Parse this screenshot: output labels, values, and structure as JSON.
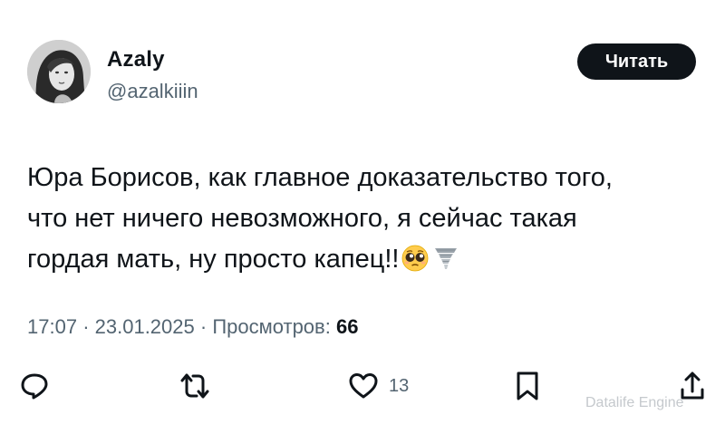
{
  "author": {
    "display_name": "Azaly",
    "handle": "@azalkiiin"
  },
  "follow_button": {
    "label": "Читать"
  },
  "tweet": {
    "lines": [
      "Юра Борисов, как главное доказательство того,",
      "что нет ничего невозможного, я сейчас такая",
      "гордая мать, ну просто капец!!"
    ],
    "emojis": [
      "pleading-face",
      "tornado"
    ]
  },
  "meta": {
    "time": "17:07",
    "separator": "·",
    "date": "23.01.2025",
    "views_label": "Просмотров:",
    "views_count": "66"
  },
  "actions": {
    "reply_icon": "reply-icon",
    "repost_icon": "repost-icon",
    "like_icon": "heart-icon",
    "like_count": "13",
    "bookmark_icon": "bookmark-icon",
    "share_icon": "share-icon"
  },
  "watermark": "Datalife Engine",
  "colors": {
    "text": "#0f1419",
    "secondary": "#536471",
    "button_bg": "#0f1419",
    "button_text": "#ffffff"
  }
}
